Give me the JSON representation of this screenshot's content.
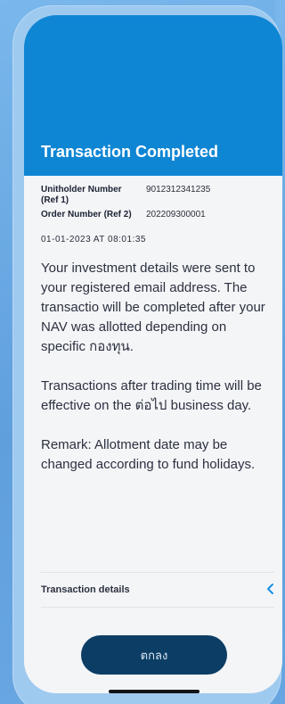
{
  "header": {
    "title": "Transaction Completed"
  },
  "references": [
    {
      "label": "Unitholder Number (Ref 1)",
      "value": "9012312341235"
    },
    {
      "label": "Order Number (Ref 2)",
      "value": "202209300001"
    }
  ],
  "datetime": "01-01-2023 AT 08:01:35",
  "message": {
    "paragraph1": "Your investment details were sent to your registered email address. The transactio will be completed after your NAV was allotted depending on specific กองทุน.",
    "paragraph2": "Transactions after trading time will be effective on the ต่อไป business day.",
    "paragraph3": "Remark: Allotment date may be changed according to fund holidays."
  },
  "details": {
    "label": "Transaction details",
    "icon": "chevron-left-icon"
  },
  "ok_button": {
    "label": "ตกลง"
  },
  "colors": {
    "header": "#0f86d4",
    "button": "#0c3d65",
    "accent": "#1a8ee0",
    "background": "#f4f5f7"
  }
}
